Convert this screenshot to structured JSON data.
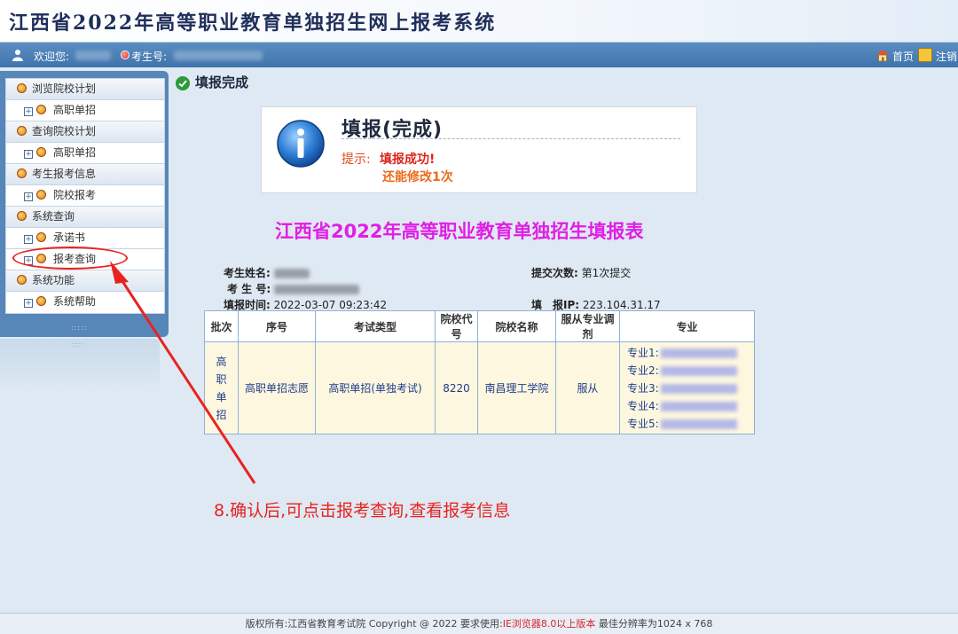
{
  "banner": {
    "title": "江西省2022年高等职业教育单独招生网上报考系统"
  },
  "topbar": {
    "welcome_label": "欢迎您:",
    "exam_no_label": "考生号:",
    "home_label": "首页",
    "logout_label": "注销"
  },
  "sidebar": {
    "groups": [
      {
        "label": "浏览院校计划",
        "items": [
          "高职单招"
        ]
      },
      {
        "label": "查询院校计划",
        "items": [
          "高职单招"
        ]
      },
      {
        "label": "考生报考信息",
        "items": [
          "院校报考"
        ]
      },
      {
        "label": "系统查询",
        "items": [
          "承诺书",
          "报考查询"
        ]
      },
      {
        "label": "系统功能",
        "items": [
          "系统帮助"
        ]
      }
    ]
  },
  "status": {
    "title": "填报完成"
  },
  "notice": {
    "title": "填报(完成)",
    "hint_label": "提示:",
    "message": "填报成功!",
    "remaining": "还能修改1次"
  },
  "form": {
    "title": "江西省2022年高等职业教育单独招生填报表",
    "name_label": "考生姓名:",
    "exam_no_label": "考 生 号:",
    "time_label": "填报时间:",
    "time_value": "2022-03-07 09:23:42",
    "submit_label": "提交次数:",
    "submit_value": "第1次提交",
    "ip_label": "填　报IP:",
    "ip_value": "223.104.31.17"
  },
  "table": {
    "headers": [
      "批次",
      "序号",
      "考试类型",
      "院校代号",
      "院校名称",
      "服从专业调剂",
      "专业"
    ],
    "row": {
      "batch": "高职单招",
      "seq": "高职单招志愿",
      "exam_type": "高职单招(单独考试)",
      "school_code": "8220",
      "school_name": "南昌理工学院",
      "adjust": "服从",
      "majors": [
        "专业1:",
        "专业2:",
        "专业3:",
        "专业4:",
        "专业5:"
      ]
    }
  },
  "annotation": {
    "text": "8.确认后,可点击报考查询,查看报考信息"
  },
  "footer": {
    "prefix": "版权所有:江西省教育考试院 Copyright @ 2022 要求使用:",
    "browser": "IE浏览器8.0以上版本",
    "suffix": " 最佳分辨率为1024 x 768"
  },
  "colors": {
    "form_title": "#e11ee6",
    "annotation": "#e8231f",
    "topbar": "#4a7fb8"
  }
}
